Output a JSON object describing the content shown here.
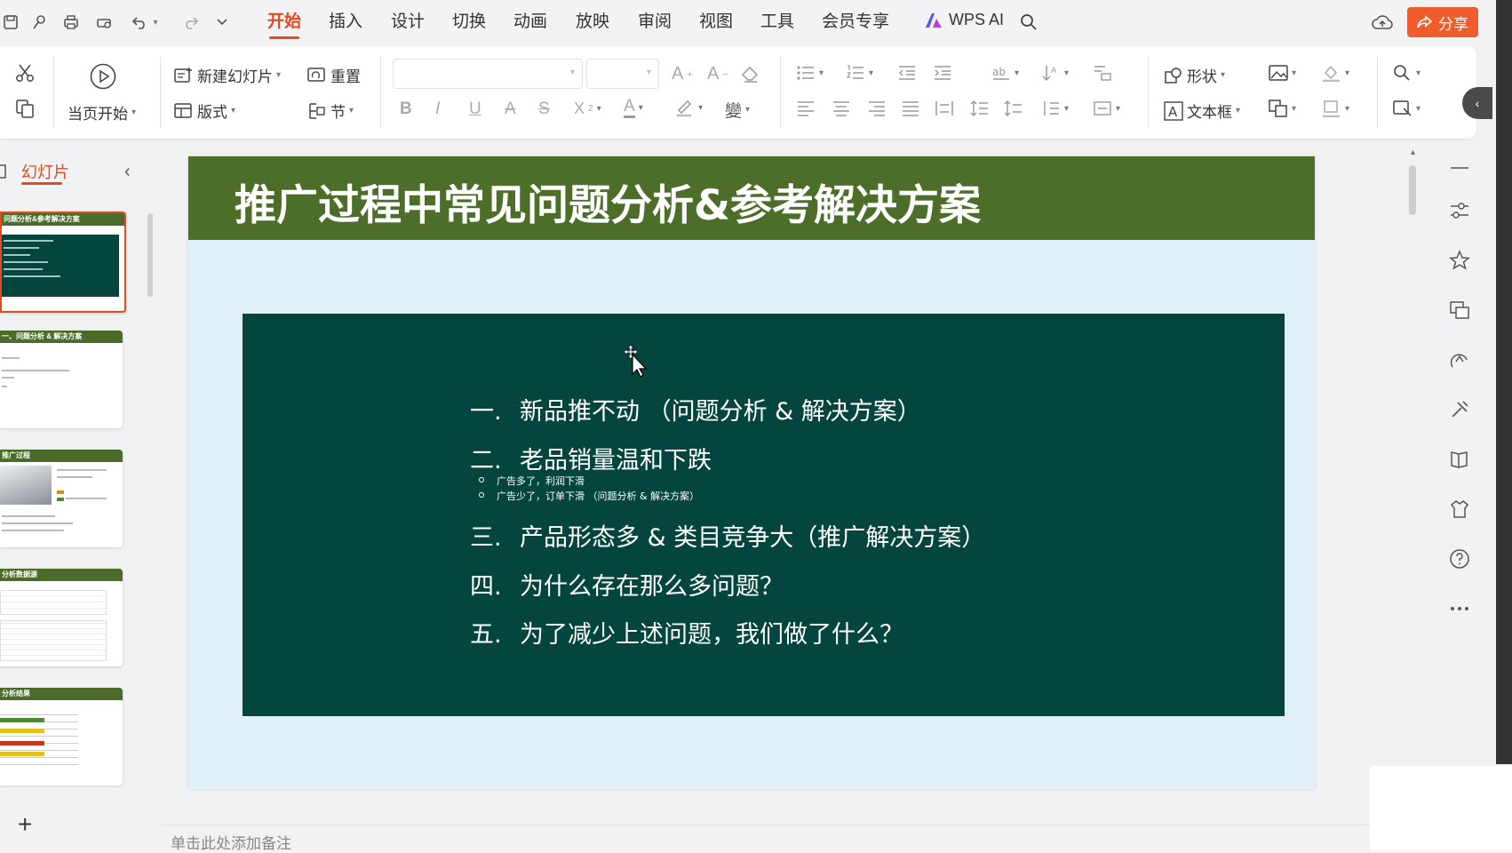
{
  "menu": {
    "tabs": [
      "开始",
      "插入",
      "设计",
      "切换",
      "动画",
      "放映",
      "审阅",
      "视图",
      "工具",
      "会员专享"
    ],
    "active_tab": "开始",
    "ai_label": "WPS AI",
    "share_label": "分享"
  },
  "ribbon": {
    "from_current": "当页开始",
    "new_slide": "新建幻灯片",
    "reset": "重置",
    "layout": "版式",
    "section": "节",
    "shape": "形状",
    "textbox": "文本框"
  },
  "panel": {
    "tab_label": "幻灯片",
    "thumbs": [
      {
        "header": "问题分析&参考解决方案"
      },
      {
        "header": "一、问题分析 & 解决方案"
      },
      {
        "header": "推广过程"
      },
      {
        "header": "分析数据源"
      },
      {
        "header": "分析结果"
      }
    ],
    "add": "+"
  },
  "slide": {
    "title": "推广过程中常见问题分析&参考解决方案",
    "items": [
      {
        "num": "一.",
        "text": "新品推不动 （问题分析 & 解决方案）"
      },
      {
        "num": "二.",
        "text": "老品销量温和下跌"
      },
      {
        "num": "三.",
        "text": "产品形态多 & 类目竞争大（推广解决方案）"
      },
      {
        "num": "四.",
        "text": "为什么存在那么多问题？"
      },
      {
        "num": "五.",
        "text": "为了减少上述问题，我们做了什么？"
      }
    ],
    "subitems": [
      "广告多了，利润下滑",
      "广告少了，订单下滑 （问题分析 & 解决方案）"
    ]
  },
  "notes": {
    "placeholder": "单击此处添加备注"
  },
  "colors": {
    "accent": "#e34a1e",
    "banner": "#4c6e29",
    "box": "#04463f",
    "slide_bg": "#dff0fb"
  }
}
